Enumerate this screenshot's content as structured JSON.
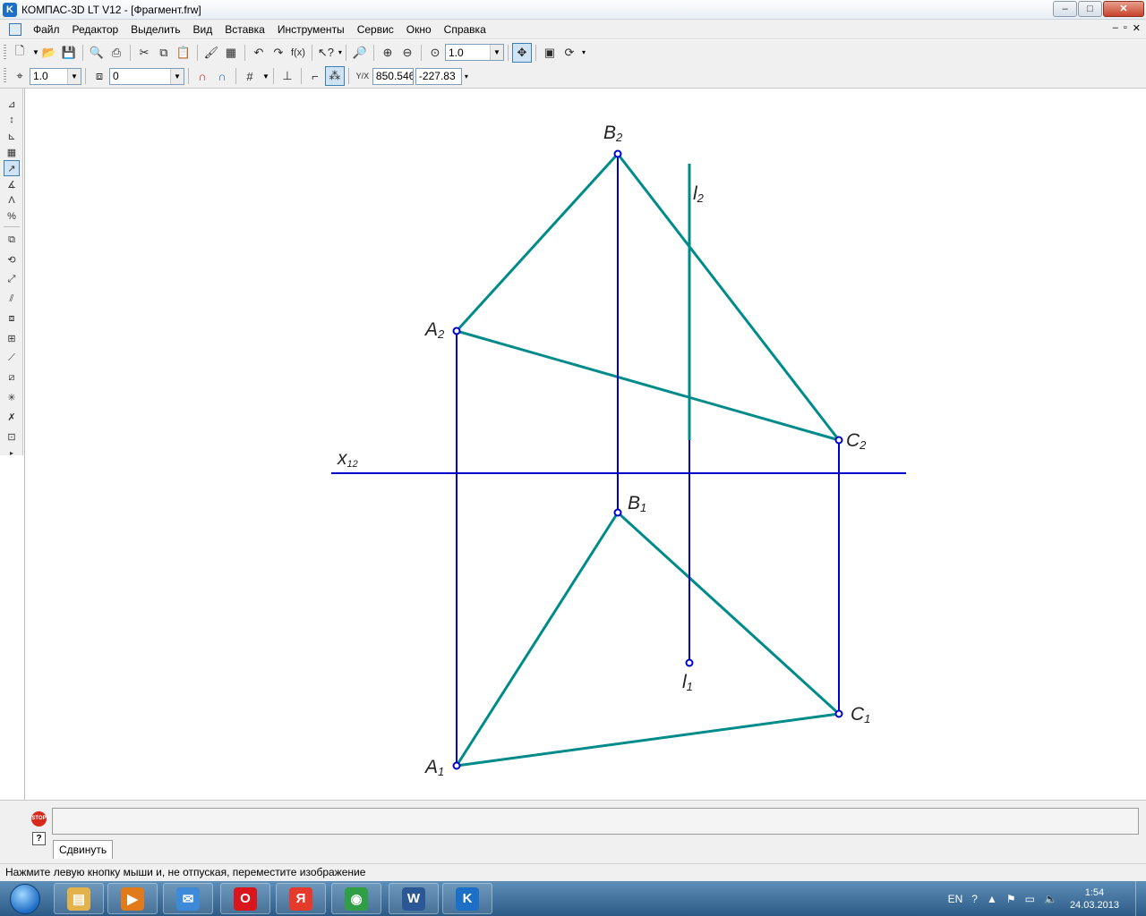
{
  "window": {
    "title": "КОМПАС-3D LT V12 - [Фрагмент.frw]",
    "app_icon": "kompas-logo-icon",
    "controls": {
      "minimize": "‒",
      "maximize": "□",
      "close": "✕"
    }
  },
  "menu": {
    "items": [
      "Файл",
      "Редактор",
      "Выделить",
      "Вид",
      "Вставка",
      "Инструменты",
      "Сервис",
      "Окно",
      "Справка"
    ],
    "mdi_controls": [
      "–",
      "▫",
      "✕"
    ]
  },
  "toolbar_standard": {
    "zoom_value": "1.0"
  },
  "toolbar_current_state": {
    "step_value": "1.0",
    "layer_value": "0",
    "x_coord": "850.546",
    "y_coord": "-227.83"
  },
  "drawing": {
    "line_color_frontal": "#008b8b",
    "line_color_projection": "#0000cd",
    "labels": {
      "B2": "B",
      "B2_sub": "2",
      "l2": "l",
      "l2_sub": "2",
      "A2": "A",
      "A2_sub": "2",
      "C2": "C",
      "C2_sub": "2",
      "x12": "x",
      "x12_sub": "12",
      "B1": "B",
      "B1_sub": "1",
      "l1": "l",
      "l1_sub": "1",
      "C1": "C",
      "C1_sub": "1",
      "A1": "A",
      "A1_sub": "1"
    }
  },
  "bottom_panel": {
    "command_tab": "Сдвинуть",
    "stop_label": "STOP",
    "help_label": "?"
  },
  "status": {
    "message": "Нажмите левую кнопку мыши и, не отпуская, переместите изображение"
  },
  "taskbar": {
    "apps": [
      {
        "name": "explorer",
        "icon": "folder-icon",
        "glyph": "▤",
        "color": "#e3b24a"
      },
      {
        "name": "media",
        "icon": "media-player-icon",
        "glyph": "▶",
        "color": "#e07a1a"
      },
      {
        "name": "mail",
        "icon": "mail-icon",
        "glyph": "✉",
        "color": "#3c8ad8"
      },
      {
        "name": "opera",
        "icon": "opera-icon",
        "glyph": "O",
        "color": "#d8161b"
      },
      {
        "name": "yandex",
        "icon": "yandex-browser-icon",
        "glyph": "Я",
        "color": "#e53b2c"
      },
      {
        "name": "chrome",
        "icon": "chrome-icon",
        "glyph": "◉",
        "color": "#2f9e44"
      },
      {
        "name": "word",
        "icon": "word-icon",
        "glyph": "W",
        "color": "#2b5797"
      },
      {
        "name": "kompas",
        "icon": "kompas-icon",
        "glyph": "K",
        "color": "#1c6fc6"
      }
    ],
    "lang": "EN",
    "time": "1:54",
    "date": "24.03.2013"
  }
}
